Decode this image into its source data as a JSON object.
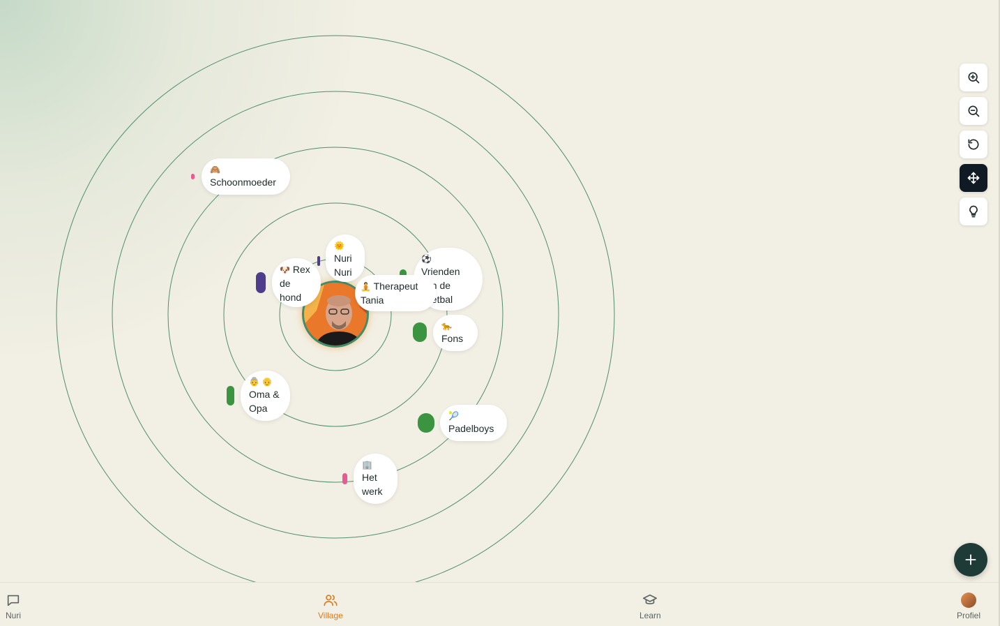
{
  "map": {
    "nodes": [
      {
        "id": "schoonmoeder",
        "emoji": "🙈",
        "label": "Schoonmoeder"
      },
      {
        "id": "nuri",
        "emoji": "🌞",
        "label": "Nuri\nNuri"
      },
      {
        "id": "rex",
        "emoji": "🐶",
        "label": "Rex\nde\nhond"
      },
      {
        "id": "therapeut",
        "emoji": "🧘",
        "label": "Therapeut\nTania"
      },
      {
        "id": "vrienden",
        "emoji": "⚽",
        "label": "Vrienden\nvan de\nvoetbal"
      },
      {
        "id": "fons",
        "emoji": "🐆",
        "label": "Fons"
      },
      {
        "id": "oma-opa",
        "emoji": "👵 👴",
        "label": "Oma &\nOpa"
      },
      {
        "id": "padelboys",
        "emoji": "🎾",
        "label": "Padelboys"
      },
      {
        "id": "werk",
        "emoji": "🏢",
        "label": "Het\nwerk"
      }
    ],
    "colors": {
      "ring": "#4f8f6d",
      "green": "#3a9440",
      "purple": "#4d3d8c",
      "pink": "#e85a92",
      "accent": "#e07b1a",
      "fab": "#1f3b38"
    }
  },
  "controls": [
    {
      "name": "zoom-in-icon"
    },
    {
      "name": "zoom-out-icon"
    },
    {
      "name": "reset-icon"
    },
    {
      "name": "move-icon",
      "active": true
    },
    {
      "name": "lightbulb-icon"
    }
  ],
  "nav": {
    "items": [
      {
        "label": "Nuri",
        "icon": "chat-icon"
      },
      {
        "label": "Village",
        "icon": "users-icon",
        "active": true
      },
      {
        "label": "Learn",
        "icon": "graduation-cap-icon"
      },
      {
        "label": "Profiel",
        "icon": "avatar"
      }
    ]
  }
}
